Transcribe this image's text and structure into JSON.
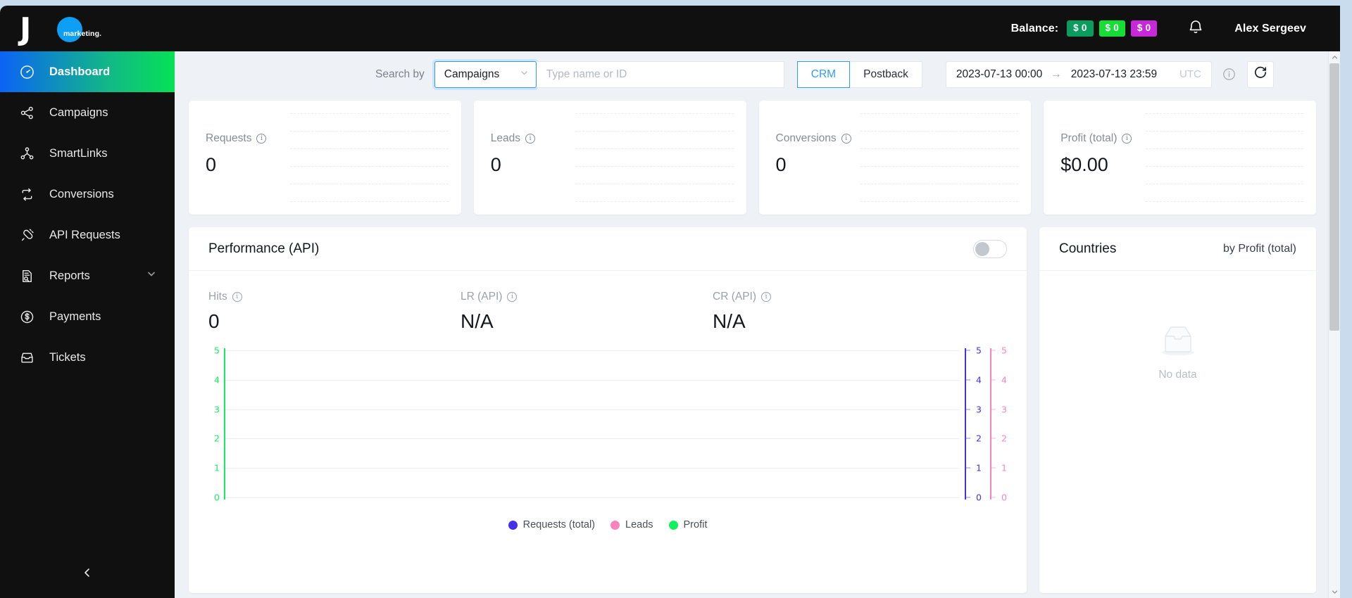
{
  "brand": {
    "letter": "J",
    "word": "marketing."
  },
  "header": {
    "balance_label": "Balance:",
    "badges": [
      {
        "text": "$ 0",
        "color": "#0a9c5e"
      },
      {
        "text": "$ 0",
        "color": "#17dd37"
      },
      {
        "text": "$ 0",
        "color": "#c728d8"
      }
    ],
    "bell_icon": "bell-icon",
    "username": "Alex Sergeev"
  },
  "sidebar": {
    "items": [
      {
        "label": "Dashboard",
        "icon": "gauge-icon",
        "active": true,
        "expandable": false
      },
      {
        "label": "Campaigns",
        "icon": "share-nodes-icon",
        "active": false,
        "expandable": false
      },
      {
        "label": "SmartLinks",
        "icon": "sitemap-icon",
        "active": false,
        "expandable": false
      },
      {
        "label": "Conversions",
        "icon": "repeat-icon",
        "active": false,
        "expandable": false
      },
      {
        "label": "API Requests",
        "icon": "plug-icon",
        "active": false,
        "expandable": false
      },
      {
        "label": "Reports",
        "icon": "file-search-icon",
        "active": false,
        "expandable": true
      },
      {
        "label": "Payments",
        "icon": "dollar-circle-icon",
        "active": false,
        "expandable": false
      },
      {
        "label": "Tickets",
        "icon": "inbox-icon",
        "active": false,
        "expandable": false
      }
    ],
    "collapse_icon": "chevron-left-icon"
  },
  "toolbar": {
    "search_by_label": "Search by",
    "select_value": "Campaigns",
    "search_placeholder": "Type name or ID",
    "search_value": "",
    "segments": [
      {
        "label": "CRM",
        "active": true
      },
      {
        "label": "Postback",
        "active": false
      }
    ],
    "date_from": "2023-07-13 00:00",
    "date_arrow": "→",
    "date_to": "2023-07-13 23:59",
    "timezone": "UTC",
    "info_icon": "info-circle-icon",
    "refresh_icon": "refresh-icon"
  },
  "kpis": [
    {
      "title": "Requests",
      "value": "0"
    },
    {
      "title": "Leads",
      "value": "0"
    },
    {
      "title": "Conversions",
      "value": "0"
    },
    {
      "title": "Profit (total)",
      "value": "$0.00"
    }
  ],
  "performance": {
    "title": "Performance (API)",
    "toggle_on": false,
    "metrics": [
      {
        "label": "Hits",
        "value": "0"
      },
      {
        "label": "LR (API)",
        "value": "N/A"
      },
      {
        "label": "CR (API)",
        "value": "N/A"
      }
    ]
  },
  "countries": {
    "title": "Countries",
    "subtitle": "by Profit (total)",
    "empty_icon": "empty-box-icon",
    "empty_text": "No data"
  },
  "chart_data": {
    "type": "line",
    "title": "Performance (API)",
    "x": [],
    "grid": true,
    "legend_position": "bottom",
    "series": [
      {
        "name": "Requests (total)",
        "color": "#4432e8",
        "values": [],
        "axis": "right-1",
        "ylim": [
          0,
          5
        ]
      },
      {
        "name": "Leads",
        "color": "#f984bd",
        "values": [],
        "axis": "right-2",
        "ylim": [
          0,
          5
        ]
      },
      {
        "name": "Profit",
        "color": "#14ef5d",
        "values": [],
        "axis": "left",
        "ylim": [
          0,
          5
        ]
      }
    ],
    "axes": [
      {
        "id": "left",
        "color": "#14ef5d",
        "ticks": [
          5,
          4,
          3,
          2,
          1,
          0
        ],
        "side": "left"
      },
      {
        "id": "right-1",
        "color": "#4432e8",
        "ticks": [
          5,
          4,
          3,
          2,
          1,
          0
        ],
        "side": "right"
      },
      {
        "id": "right-2",
        "color": "#f984bd",
        "ticks": [
          5,
          4,
          3,
          2,
          1,
          0
        ],
        "side": "right"
      }
    ],
    "xlabel": "",
    "ylabel": ""
  },
  "scrollbar": {
    "up_icon": "chevron-up-icon",
    "down_icon": "chevron-down-icon"
  }
}
